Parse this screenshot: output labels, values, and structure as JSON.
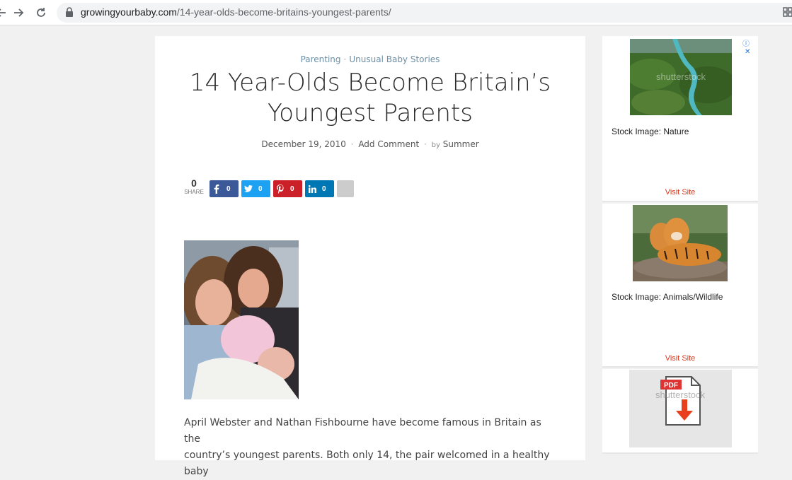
{
  "browser": {
    "url_domain": "growingyourbaby.com",
    "url_path": "/14-year-olds-become-britains-youngest-parents/",
    "icons": [
      "back-arrow-icon",
      "forward-arrow-icon",
      "reload-icon",
      "lock-icon",
      "extensions-icon"
    ]
  },
  "article": {
    "categories": [
      "Parenting",
      "Unusual Baby Stories"
    ],
    "category_separator": "·",
    "title_line1": "14 Year-Olds Become Britain’s",
    "title_line2": "Youngest Parents",
    "date": "December 19, 2010",
    "meta_separator": "·",
    "comment_link": "Add Comment",
    "by_label": "by",
    "author": "Summer",
    "share_total": "0",
    "share_label": "SHARE",
    "share_buttons": [
      {
        "network": "facebook",
        "icon": "facebook-icon",
        "count": "0",
        "color": "#3b5998"
      },
      {
        "network": "twitter",
        "icon": "twitter-icon",
        "count": "0",
        "color": "#1da1f2"
      },
      {
        "network": "pinterest",
        "icon": "pinterest-icon",
        "count": "0",
        "color": "#cb2027"
      },
      {
        "network": "linkedin",
        "icon": "linkedin-icon",
        "count": "0",
        "color": "#0077b5"
      }
    ],
    "body_line1": "April Webster and Nathan Fishbourne have become famous in Britain as the",
    "body_line2": "country’s youngest parents. Both only 14, the pair welcomed in a healthy baby"
  },
  "ads": [
    {
      "caption": "Stock Image: Nature",
      "visit": "Visit Site",
      "watermark": "shutterstock"
    },
    {
      "caption": "Stock Image: Animals/Wildlife",
      "visit": "Visit Site"
    },
    {
      "badge": "PDF",
      "watermark": "shutterstock"
    }
  ],
  "ad_choices_icons": [
    "adchoices-icon",
    "close-icon"
  ]
}
